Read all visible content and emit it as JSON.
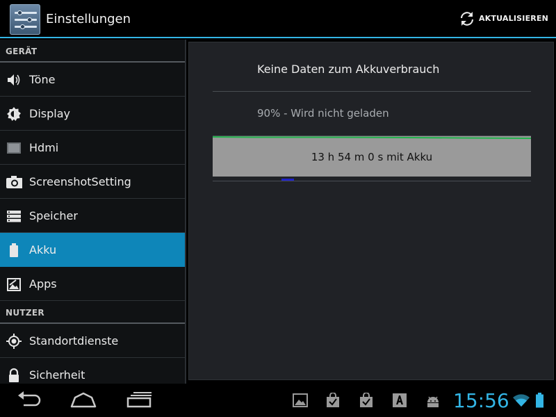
{
  "app": {
    "title": "Einstellungen",
    "refresh_label": "AKTUALISIEREN",
    "accent_color": "#33b5e5"
  },
  "sidebar": {
    "sections": [
      {
        "header": "GERÄT",
        "items": [
          {
            "label": "Töne",
            "icon": "speaker-icon"
          },
          {
            "label": "Display",
            "icon": "brightness-icon"
          },
          {
            "label": "Hdmi",
            "icon": "hdmi-icon"
          },
          {
            "label": "ScreenshotSetting",
            "icon": "camera-icon"
          },
          {
            "label": "Speicher",
            "icon": "storage-icon"
          },
          {
            "label": "Akku",
            "icon": "battery-icon",
            "selected": true
          },
          {
            "label": "Apps",
            "icon": "apps-icon"
          }
        ]
      },
      {
        "header": "NUTZER",
        "items": [
          {
            "label": "Standortdienste",
            "icon": "location-icon"
          },
          {
            "label": "Sicherheit",
            "icon": "lock-icon"
          }
        ]
      }
    ]
  },
  "battery": {
    "no_data": "Keine Daten zum Akkuverbrauch",
    "status": "90% - Wird nicht geladen",
    "graph_label": "13 h 54 m 0 s mit Akku",
    "graph_color": "#9a9a9a",
    "graph_line_color": "#22b24c"
  },
  "statusbar": {
    "time": "15:56",
    "time_color": "#33b5e5",
    "notification_icons": [
      "gallery-icon",
      "play-store-icon",
      "play-store-icon",
      "font-app-icon",
      "android-icon"
    ],
    "nav_buttons": [
      "back-icon",
      "home-icon",
      "recent-apps-icon"
    ]
  }
}
